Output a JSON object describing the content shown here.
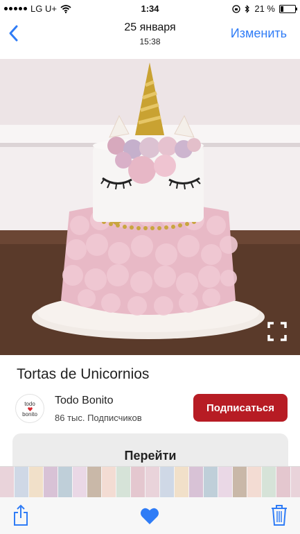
{
  "status_bar": {
    "carrier": "LG U+",
    "time": "1:34",
    "battery": "21 %",
    "battery_level": 0.21
  },
  "nav": {
    "title": "25 января",
    "subtitle": "15:38",
    "edit_label": "Изменить"
  },
  "pin": {
    "title": "Tortas de Unicornios",
    "board_name": "Todo Bonito",
    "followers": "86 тыс. Подписчиков",
    "subscribe_label": "Подписаться",
    "goto_label": "Перейти",
    "logo_line1": "todo",
    "logo_line2": "bonito"
  },
  "colors": {
    "accent": "#2f7cf6",
    "subscribe_bg": "#b71c24",
    "like": "#2f7cf6"
  },
  "icons": {
    "back": "chevron-left-icon",
    "fullscreen": "fullscreen-icon",
    "share": "share-icon",
    "like": "heart-icon",
    "delete": "trash-icon"
  }
}
